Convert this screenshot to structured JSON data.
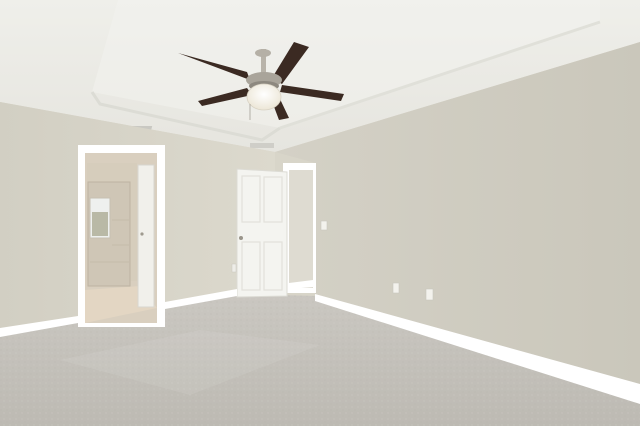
{
  "scene": {
    "description_free": true,
    "colors": {
      "ceiling": "#ebebe6",
      "ceiling_tray": "#f2f2ee",
      "wall_left": "#d6d3c7",
      "wall_right": "#cfccc0",
      "wall_back": "#d9d6ca",
      "carpet": "#c4c1bb",
      "trim": "#ffffff",
      "door": "#f4f4f0",
      "fan_blade": "#3b2a22",
      "fan_metal": "#a8a39a",
      "light": "#fbf8ef",
      "bath_tile": "#d8d0c2",
      "bath_floor": "#e2d5c2"
    },
    "objects": [
      "ceiling-fan",
      "light-fixture",
      "interior-door",
      "bathroom-doorway",
      "baseboard",
      "wall-outlet",
      "light-switch",
      "ceiling-vent",
      "carpet-floor"
    ]
  }
}
